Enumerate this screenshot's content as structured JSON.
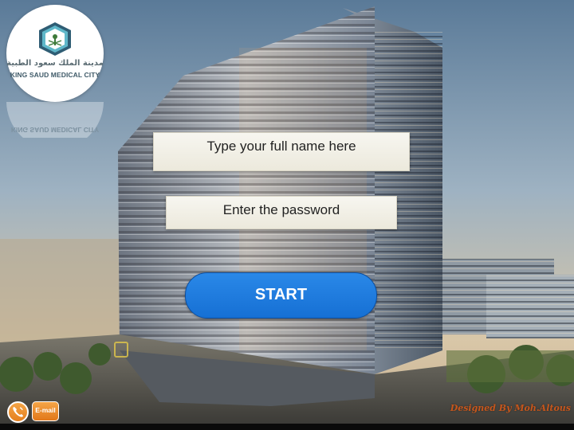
{
  "logo": {
    "arabic_text": "مدينة الملك سعود الطبية",
    "english_text": "KING SAUD MEDICAL CITY",
    "reflection_text": "KING SAUD MEDICAL CITY"
  },
  "form": {
    "name_field_text": "Type your full  name here",
    "password_field_text": "Enter the password",
    "start_label": "START"
  },
  "footer": {
    "email_label": "E-mail",
    "credit": "Designed By Moh.Altous"
  },
  "colors": {
    "start_button": "#1670d4",
    "contact_buttons": "#e57f1d",
    "credit_text": "#c5561c"
  }
}
